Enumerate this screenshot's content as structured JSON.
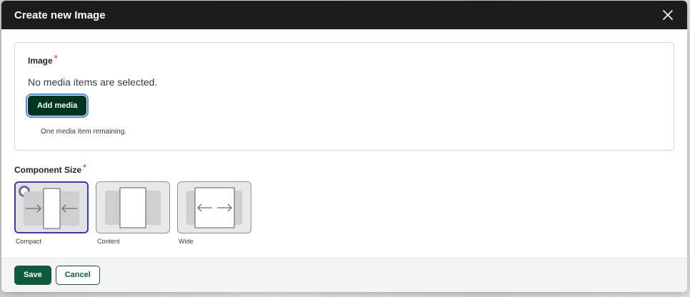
{
  "dialog": {
    "title": "Create new Image",
    "close_icon": "close-icon"
  },
  "image_field": {
    "label": "Image",
    "required_marker": "*",
    "empty_text": "No media items are selected.",
    "add_button": "Add media",
    "remaining_text": "One media item remaining."
  },
  "component_size": {
    "label": "Component Size",
    "required_marker": "*",
    "options": [
      {
        "label": "Compact",
        "selected": true
      },
      {
        "label": "Content",
        "selected": false
      },
      {
        "label": "Wide",
        "selected": false
      }
    ]
  },
  "footer": {
    "save_label": "Save",
    "cancel_label": "Cancel"
  },
  "colors": {
    "titlebar": "#1c1c1f",
    "primary": "#0f5a3a",
    "selected_border": "#3b3f9a",
    "required": "#d72222"
  }
}
